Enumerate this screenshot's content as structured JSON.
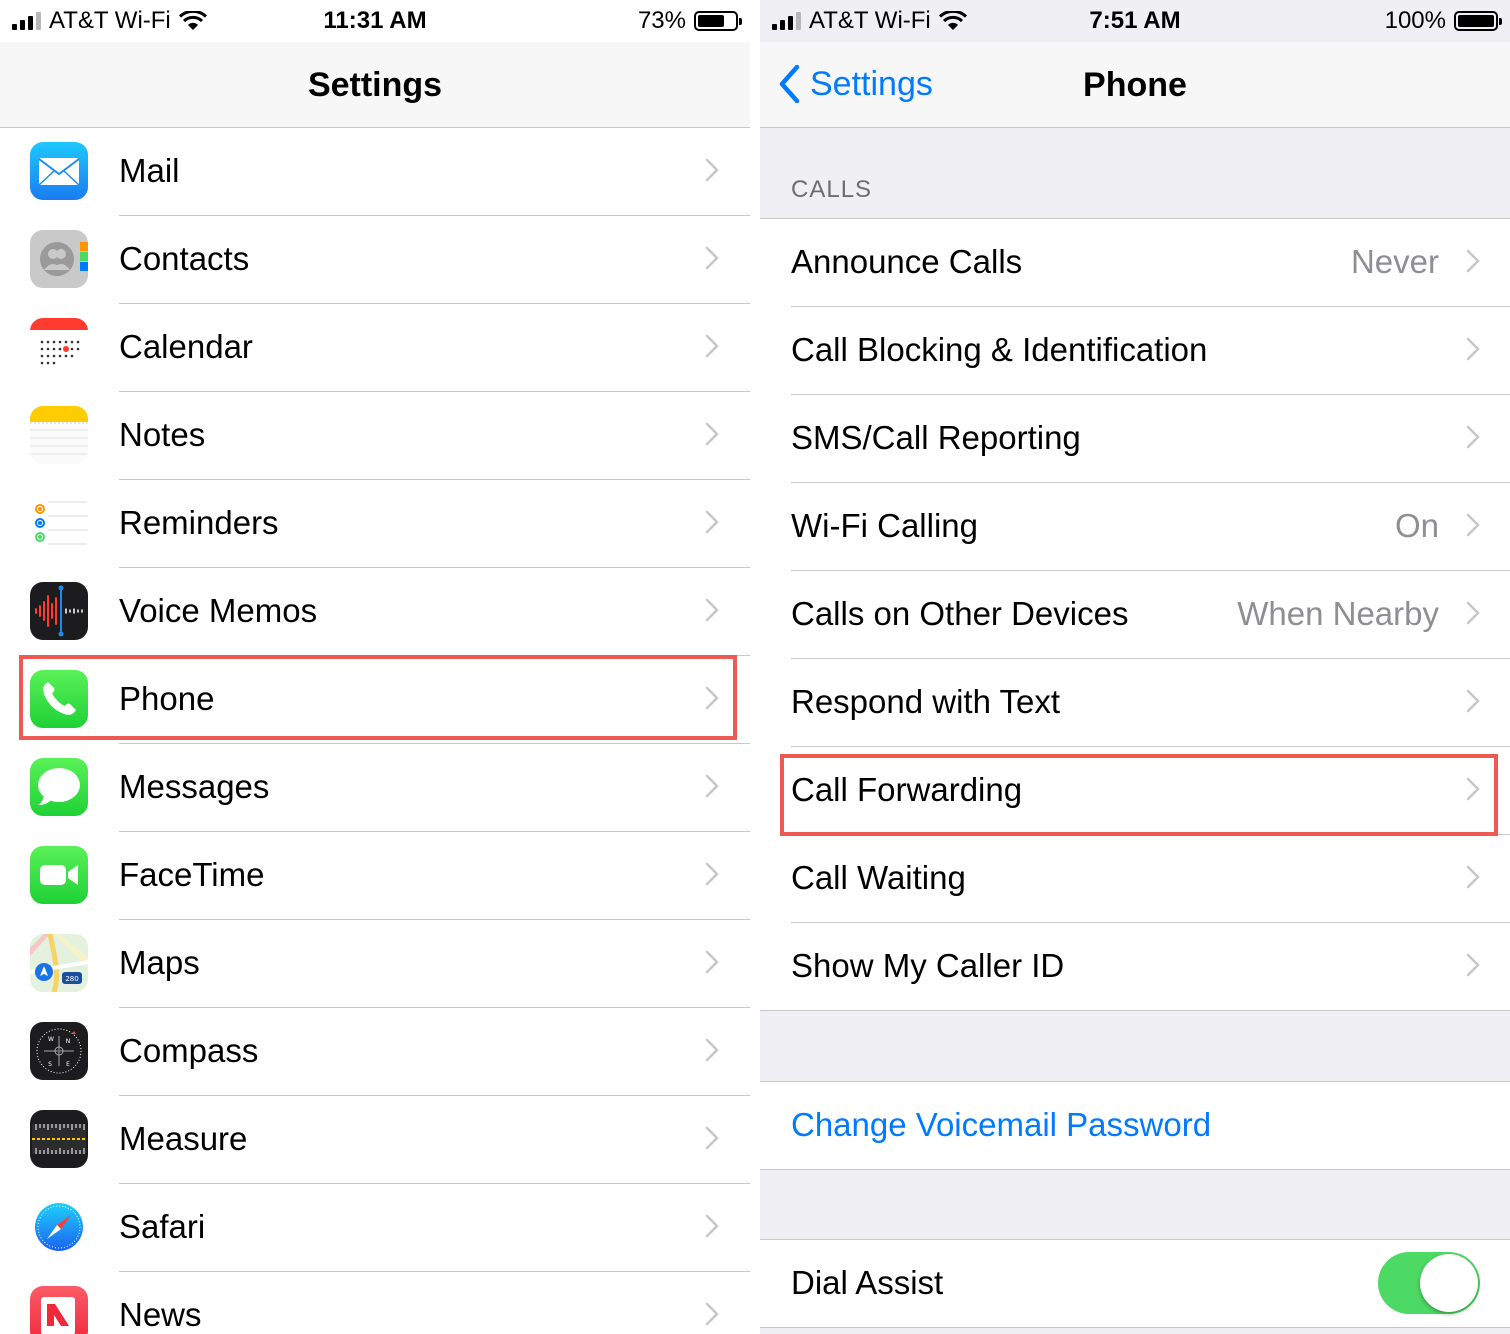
{
  "left": {
    "status": {
      "carrier": "AT&T Wi-Fi",
      "time": "11:31 AM",
      "battery": "73%",
      "battery_level": 0.73
    },
    "nav": {
      "title": "Settings"
    },
    "items": [
      {
        "label": "Mail",
        "icon": "mail-icon",
        "color": "#1b8cf5"
      },
      {
        "label": "Contacts",
        "icon": "contacts-icon",
        "color": "#9b9b9b"
      },
      {
        "label": "Calendar",
        "icon": "calendar-icon",
        "color": "#ffffff"
      },
      {
        "label": "Notes",
        "icon": "notes-icon",
        "color": "#ffffff"
      },
      {
        "label": "Reminders",
        "icon": "reminders-icon",
        "color": "#ffffff"
      },
      {
        "label": "Voice Memos",
        "icon": "voice-memos-icon",
        "color": "#1c1c1e"
      },
      {
        "label": "Phone",
        "icon": "phone-icon",
        "color": "#34c759"
      },
      {
        "label": "Messages",
        "icon": "messages-icon",
        "color": "#34c759"
      },
      {
        "label": "FaceTime",
        "icon": "facetime-icon",
        "color": "#34c759"
      },
      {
        "label": "Maps",
        "icon": "maps-icon",
        "color": "#e8f3e3"
      },
      {
        "label": "Compass",
        "icon": "compass-icon",
        "color": "#1c1c1e"
      },
      {
        "label": "Measure",
        "icon": "measure-icon",
        "color": "#1c1c1e"
      },
      {
        "label": "Safari",
        "icon": "safari-icon",
        "color": "#ffffff"
      },
      {
        "label": "News",
        "icon": "news-icon",
        "color": "#f0404a"
      }
    ]
  },
  "right": {
    "status": {
      "carrier": "AT&T Wi-Fi",
      "time": "7:51 AM",
      "battery": "100%",
      "battery_level": 1.0
    },
    "nav": {
      "back_label": "Settings",
      "title": "Phone"
    },
    "calls_header": "CALLS",
    "calls": [
      {
        "label": "Announce Calls",
        "value": "Never"
      },
      {
        "label": "Call Blocking & Identification",
        "value": ""
      },
      {
        "label": "SMS/Call Reporting",
        "value": ""
      },
      {
        "label": "Wi-Fi Calling",
        "value": "On"
      },
      {
        "label": "Calls on Other Devices",
        "value": "When Nearby"
      },
      {
        "label": "Respond with Text",
        "value": ""
      },
      {
        "label": "Call Forwarding",
        "value": ""
      },
      {
        "label": "Call Waiting",
        "value": ""
      },
      {
        "label": "Show My Caller ID",
        "value": ""
      }
    ],
    "voicemail_link": "Change Voicemail Password",
    "dial_assist": {
      "label": "Dial Assist",
      "on": true
    },
    "toggle_color": "#4cd964"
  },
  "highlight_color": "#ee5a52"
}
